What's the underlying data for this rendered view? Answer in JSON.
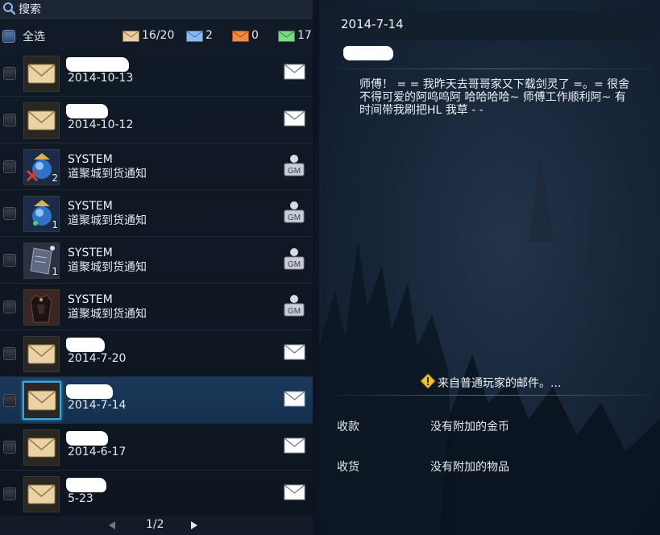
{
  "search": {
    "label": "搜索"
  },
  "header": {
    "select_all_label": "全选",
    "counts": [
      {
        "icon": "envelope-tan-icon",
        "value": "16/20"
      },
      {
        "icon": "envelope-blue-icon",
        "value": "2"
      },
      {
        "icon": "envelope-orange-icon",
        "value": "0"
      },
      {
        "icon": "envelope-green-icon",
        "value": "17"
      }
    ]
  },
  "mail_list": [
    {
      "sender": "",
      "date": "2014-10-13",
      "thumb": "envelope-thumb",
      "type": "player-mail",
      "selected": false
    },
    {
      "sender": "",
      "date": "2014-10-12",
      "thumb": "envelope-thumb",
      "type": "player-mail",
      "selected": false
    },
    {
      "sender": "SYSTEM",
      "subject": "道聚城到货通知",
      "thumb": "blue-orb-item-icon",
      "qty": "2",
      "type": "gm-mail",
      "selected": false
    },
    {
      "sender": "SYSTEM",
      "subject": "道聚城到货通知",
      "thumb": "blue-orb-item-icon",
      "qty": "1",
      "type": "gm-mail",
      "selected": false
    },
    {
      "sender": "SYSTEM",
      "subject": "道聚城到货通知",
      "thumb": "stone-tablet-item-icon",
      "qty": "1",
      "type": "gm-mail",
      "selected": false
    },
    {
      "sender": "SYSTEM",
      "subject": "道聚城到货通知",
      "thumb": "costume-item-icon",
      "type": "gm-mail",
      "selected": false
    },
    {
      "sender": "",
      "date": "2014-7-20",
      "thumb": "envelope-thumb",
      "type": "player-mail",
      "selected": false
    },
    {
      "sender": "",
      "date": "2014-7-14",
      "thumb": "envelope-thumb",
      "type": "player-mail",
      "selected": true
    },
    {
      "sender": "",
      "date": "2014-6-17",
      "thumb": "envelope-thumb",
      "type": "player-mail",
      "selected": false
    },
    {
      "sender": "",
      "date": "5-23",
      "thumb": "envelope-thumb",
      "type": "player-mail",
      "selected": false
    }
  ],
  "pager": {
    "text": "1/2"
  },
  "detail": {
    "date": "2014-7-14",
    "body": "师傅！ = = 我昨天去哥哥家又下载剑灵了 =。= 很舍不得可爱的阿呜呜阿 哈哈哈哈~ 师傅工作顺利阿~ 有时间带我刷把HL 我草 - -",
    "notice": "来自普通玩家的邮件。...",
    "money_label": "收款",
    "money_value": "没有附加的金币",
    "goods_label": "收货",
    "goods_value": "没有附加的物品"
  },
  "colors": {
    "selected_row": "#1c3858",
    "selected_border": "#3ba6e0",
    "accent_warning": "#f2c230"
  }
}
